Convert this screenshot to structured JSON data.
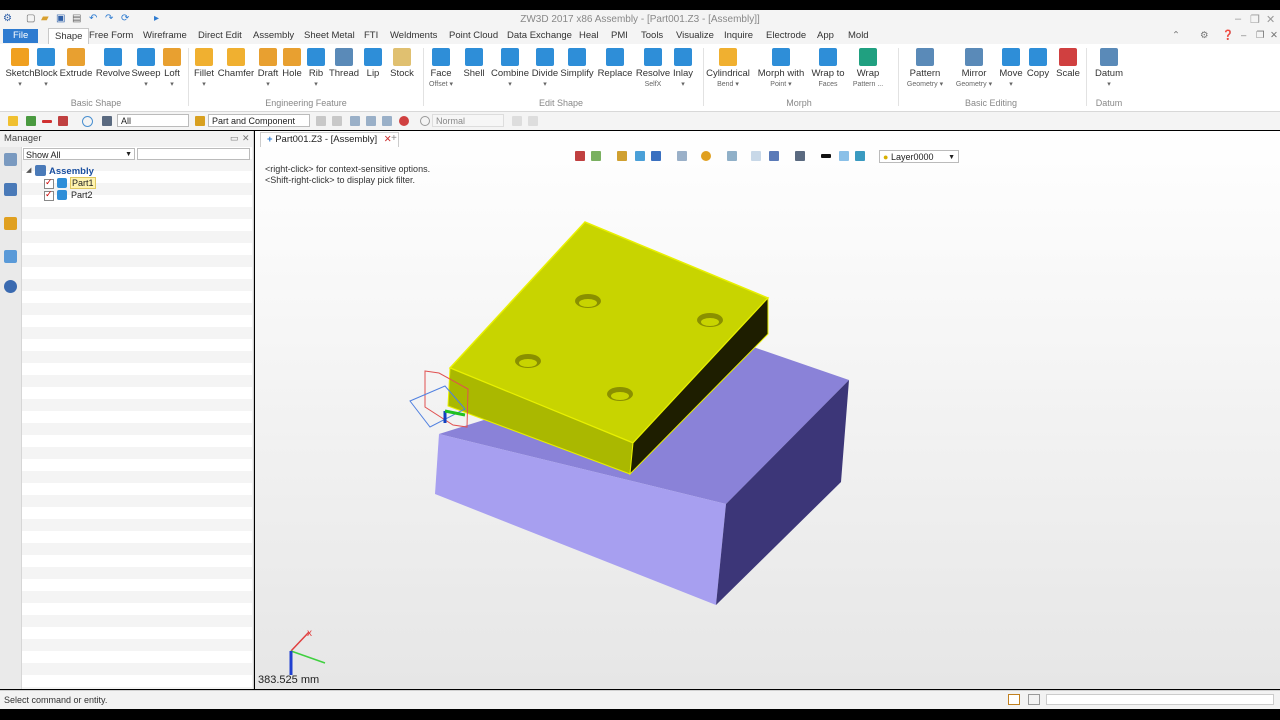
{
  "window": {
    "title": "ZW3D 2017  x86        Assembly - [Part001.Z3 - [Assembly]]"
  },
  "menubar": {
    "items": [
      "File",
      "Shape",
      "Free Form",
      "Wireframe",
      "Direct Edit",
      "Assembly",
      "Sheet Metal",
      "FTI",
      "Weldments",
      "Point Cloud",
      "Data Exchange",
      "Heal",
      "PMI",
      "Tools",
      "Visualize",
      "Inquire",
      "Electrode",
      "App",
      "Mold"
    ],
    "active": "Shape"
  },
  "ribbon": {
    "buttons": [
      {
        "id": "sketch",
        "label": "Sketch",
        "sub": "▾",
        "color": "#f0a020"
      },
      {
        "id": "block",
        "label": "Block",
        "sub": "▾",
        "color": "#2e8ed8"
      },
      {
        "id": "extrude",
        "label": "Extrude",
        "sub": "",
        "color": "#e8a030"
      },
      {
        "id": "revolve",
        "label": "Revolve",
        "sub": "",
        "color": "#2e8ed8"
      },
      {
        "id": "sweep",
        "label": "Sweep",
        "sub": "▾",
        "color": "#2e8ed8"
      },
      {
        "id": "loft",
        "label": "Loft",
        "sub": "▾",
        "color": "#e8a030"
      },
      {
        "id": "fillet",
        "label": "Fillet",
        "sub": "▾",
        "color": "#f0b030"
      },
      {
        "id": "chamfer",
        "label": "Chamfer",
        "sub": "",
        "color": "#f0b030"
      },
      {
        "id": "draft",
        "label": "Draft",
        "sub": "▾",
        "color": "#e8a030"
      },
      {
        "id": "hole",
        "label": "Hole",
        "sub": "",
        "color": "#e8a030"
      },
      {
        "id": "rib",
        "label": "Rib",
        "sub": "▾",
        "color": "#2e8ed8"
      },
      {
        "id": "thread",
        "label": "Thread",
        "sub": "",
        "color": "#5a8ab8"
      },
      {
        "id": "lip",
        "label": "Lip",
        "sub": "",
        "color": "#2e8ed8"
      },
      {
        "id": "stock",
        "label": "Stock",
        "sub": "",
        "color": "#e0c070"
      },
      {
        "id": "face-offset",
        "label": "Face",
        "sub": "Offset ▾",
        "color": "#2e8ed8"
      },
      {
        "id": "shell",
        "label": "Shell",
        "sub": "",
        "color": "#2e8ed8"
      },
      {
        "id": "combine",
        "label": "Combine",
        "sub": "▾",
        "color": "#2e8ed8"
      },
      {
        "id": "divide",
        "label": "Divide",
        "sub": "▾",
        "color": "#2e8ed8"
      },
      {
        "id": "simplify",
        "label": "Simplify",
        "sub": "",
        "color": "#2e8ed8"
      },
      {
        "id": "replace",
        "label": "Replace",
        "sub": "",
        "color": "#2e8ed8"
      },
      {
        "id": "resolve-selfx",
        "label": "Resolve",
        "sub": "SelfX",
        "color": "#2e8ed8"
      },
      {
        "id": "inlay",
        "label": "Inlay",
        "sub": "▾",
        "color": "#2e8ed8"
      },
      {
        "id": "cylindrical-bend",
        "label": "Cylindrical",
        "sub": "Bend ▾",
        "color": "#f0b030"
      },
      {
        "id": "morph-with-point",
        "label": "Morph with",
        "sub": "Point ▾",
        "color": "#2e8ed8"
      },
      {
        "id": "wrap-to-faces",
        "label": "Wrap to",
        "sub": "Faces",
        "color": "#2e8ed8"
      },
      {
        "id": "wrap-pattern",
        "label": "Wrap",
        "sub": "Pattern ...",
        "color": "#20a080"
      },
      {
        "id": "pattern-geometry",
        "label": "Pattern",
        "sub": "Geometry ▾",
        "color": "#5a8ab8"
      },
      {
        "id": "mirror-geometry",
        "label": "Mirror",
        "sub": "Geometry ▾",
        "color": "#5a8ab8"
      },
      {
        "id": "move",
        "label": "Move",
        "sub": "▾",
        "color": "#2e8ed8"
      },
      {
        "id": "copy",
        "label": "Copy",
        "sub": "",
        "color": "#2e8ed8"
      },
      {
        "id": "scale",
        "label": "Scale",
        "sub": "",
        "color": "#d04040"
      },
      {
        "id": "datum",
        "label": "Datum",
        "sub": "▾",
        "color": "#5a8ab8"
      }
    ],
    "groups": [
      "Basic Shape",
      "Engineering Feature",
      "Edit Shape",
      "Morph",
      "Basic Editing",
      "Datum"
    ]
  },
  "filterbar": {
    "filter_all": "All",
    "pick_mode": "Part and Component",
    "render_mode": "Normal"
  },
  "manager": {
    "header": "Manager",
    "show_filter": "Show All",
    "tree": {
      "root": "Assembly",
      "children": [
        "Part1",
        "Part2"
      ]
    }
  },
  "viewport": {
    "tab_label": "Part001.Z3 - [Assembly]",
    "layer": "Layer0000",
    "hint_line1": "<right-click> for context-sensitive options.",
    "hint_line2": "<Shift-right-click> to display pick filter.",
    "ruler_value": "383.525 mm"
  },
  "colors": {
    "plate_top": "#c8d400",
    "plate_front": "#aab800",
    "plate_side": "#1e1e00",
    "base_top": "#8a82d8",
    "base_front": "#a79ff0",
    "base_side": "#3c3678",
    "accent": "#2e7bd0"
  },
  "statusbar": {
    "message": "Select command or entity."
  }
}
